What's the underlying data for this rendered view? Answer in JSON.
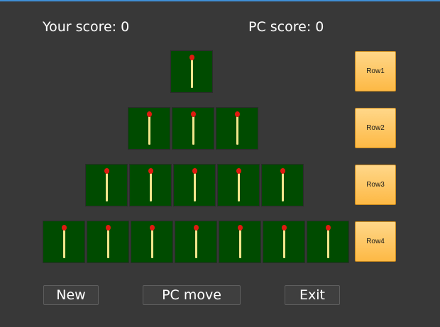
{
  "scores": {
    "your_score": "Your score: 0",
    "pc_score": "PC score: 0"
  },
  "rows": [
    {
      "label": "Row1",
      "matches": 1
    },
    {
      "label": "Row2",
      "matches": 3
    },
    {
      "label": "Row3",
      "matches": 5
    },
    {
      "label": "Row4",
      "matches": 7
    }
  ],
  "buttons": {
    "new": "New",
    "pc_move": "PC move",
    "exit": "Exit"
  },
  "colors": {
    "background": "#383838",
    "tile": "#004b00",
    "match_head": "#e01a10",
    "match_stick": "#f2e68c",
    "row_button": "#fdb945"
  }
}
